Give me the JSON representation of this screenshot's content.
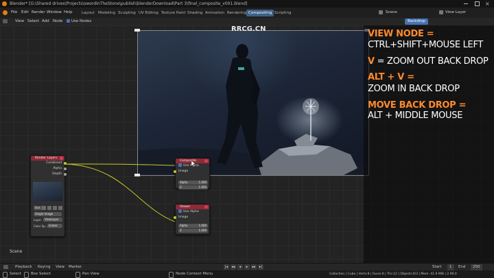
{
  "titlebar": {
    "text": "Blender* [G:\\Shared drives\\Projects\\swordInTheStone\\publish\\blenderDownload\\Part 3\\final_composite_v001.blend]"
  },
  "menu": {
    "file": "File",
    "edit": "Edit",
    "render": "Render",
    "window": "Window",
    "help": "Help"
  },
  "workspaces": [
    {
      "label": "Layout"
    },
    {
      "label": "Modeling"
    },
    {
      "label": "Sculpting"
    },
    {
      "label": "UV Editing"
    },
    {
      "label": "Texture Paint"
    },
    {
      "label": "Shading"
    },
    {
      "label": "Animation"
    },
    {
      "label": "Rendering"
    },
    {
      "label": "Compositing"
    },
    {
      "label": "Scripting"
    }
  ],
  "active_workspace": "Compositing",
  "top_right": {
    "scene": "Scene",
    "view_layer": "View Layer"
  },
  "node_header": {
    "view": "View",
    "select": "Select",
    "add": "Add",
    "node": "Node",
    "use_nodes": "Use Nodes",
    "backdrop": "Backdrop"
  },
  "watermark": "RRCG.CN",
  "overlay": {
    "line1": "VIEW NODE =",
    "line2": "CTRL+SHIFT+MOUSE LEFT",
    "line3_key": "V",
    "line3_rest": " = ZOOM OUT BACK DROP",
    "line4": "ALT + V =",
    "line5": "ZOOM IN BACK DROP",
    "line6": "MOVE BACK DROP =",
    "line7": "ALT + MIDDLE MOUSE"
  },
  "nodes": {
    "render_layers": {
      "title": "Render Layers",
      "outputs": [
        "Combined",
        "Alpha",
        "Depth"
      ],
      "scene_field": "Sce",
      "mode": "Single Image",
      "layer_label": "Layer",
      "layer_value": "ViewLayer",
      "color_label": "Color Sp...",
      "color_value": "Linear"
    },
    "composite": {
      "title": "Composite",
      "use_alpha": "Use Alpha",
      "input_image": "Image",
      "alpha_label": "Alpha",
      "alpha_value": "1.000",
      "z_label": "Z",
      "z_value": "1.000"
    },
    "viewer": {
      "title": "Viewer",
      "use_alpha": "Use Alpha",
      "input_image": "Image",
      "alpha_label": "Alpha",
      "alpha_value": "1.000",
      "z_label": "Z",
      "z_value": "1.000"
    }
  },
  "editor_label": "Scene",
  "timeline": {
    "playback": "Playback",
    "keying": "Keying",
    "view": "View",
    "marker": "Marker",
    "start_label": "Start",
    "start": "1",
    "end_label": "End",
    "end": "250"
  },
  "status": {
    "select": "Select",
    "box_select": "Box Select",
    "pan_view": "Pan View",
    "context_menu": "Node Context Menu",
    "info": "Collection | Cube | Verts:8 | Faces:6 | Tris:12 | Objects:0/3 | Mem: 41.9 MiB | 2.90.0"
  },
  "colors": {
    "accent_orange": "#ff8a2e",
    "node_header_red": "#8e2a36",
    "socket_yellow": "#c7c729",
    "socket_gray": "#a1a1a1",
    "active_tab_blue": "#3d5f86"
  }
}
